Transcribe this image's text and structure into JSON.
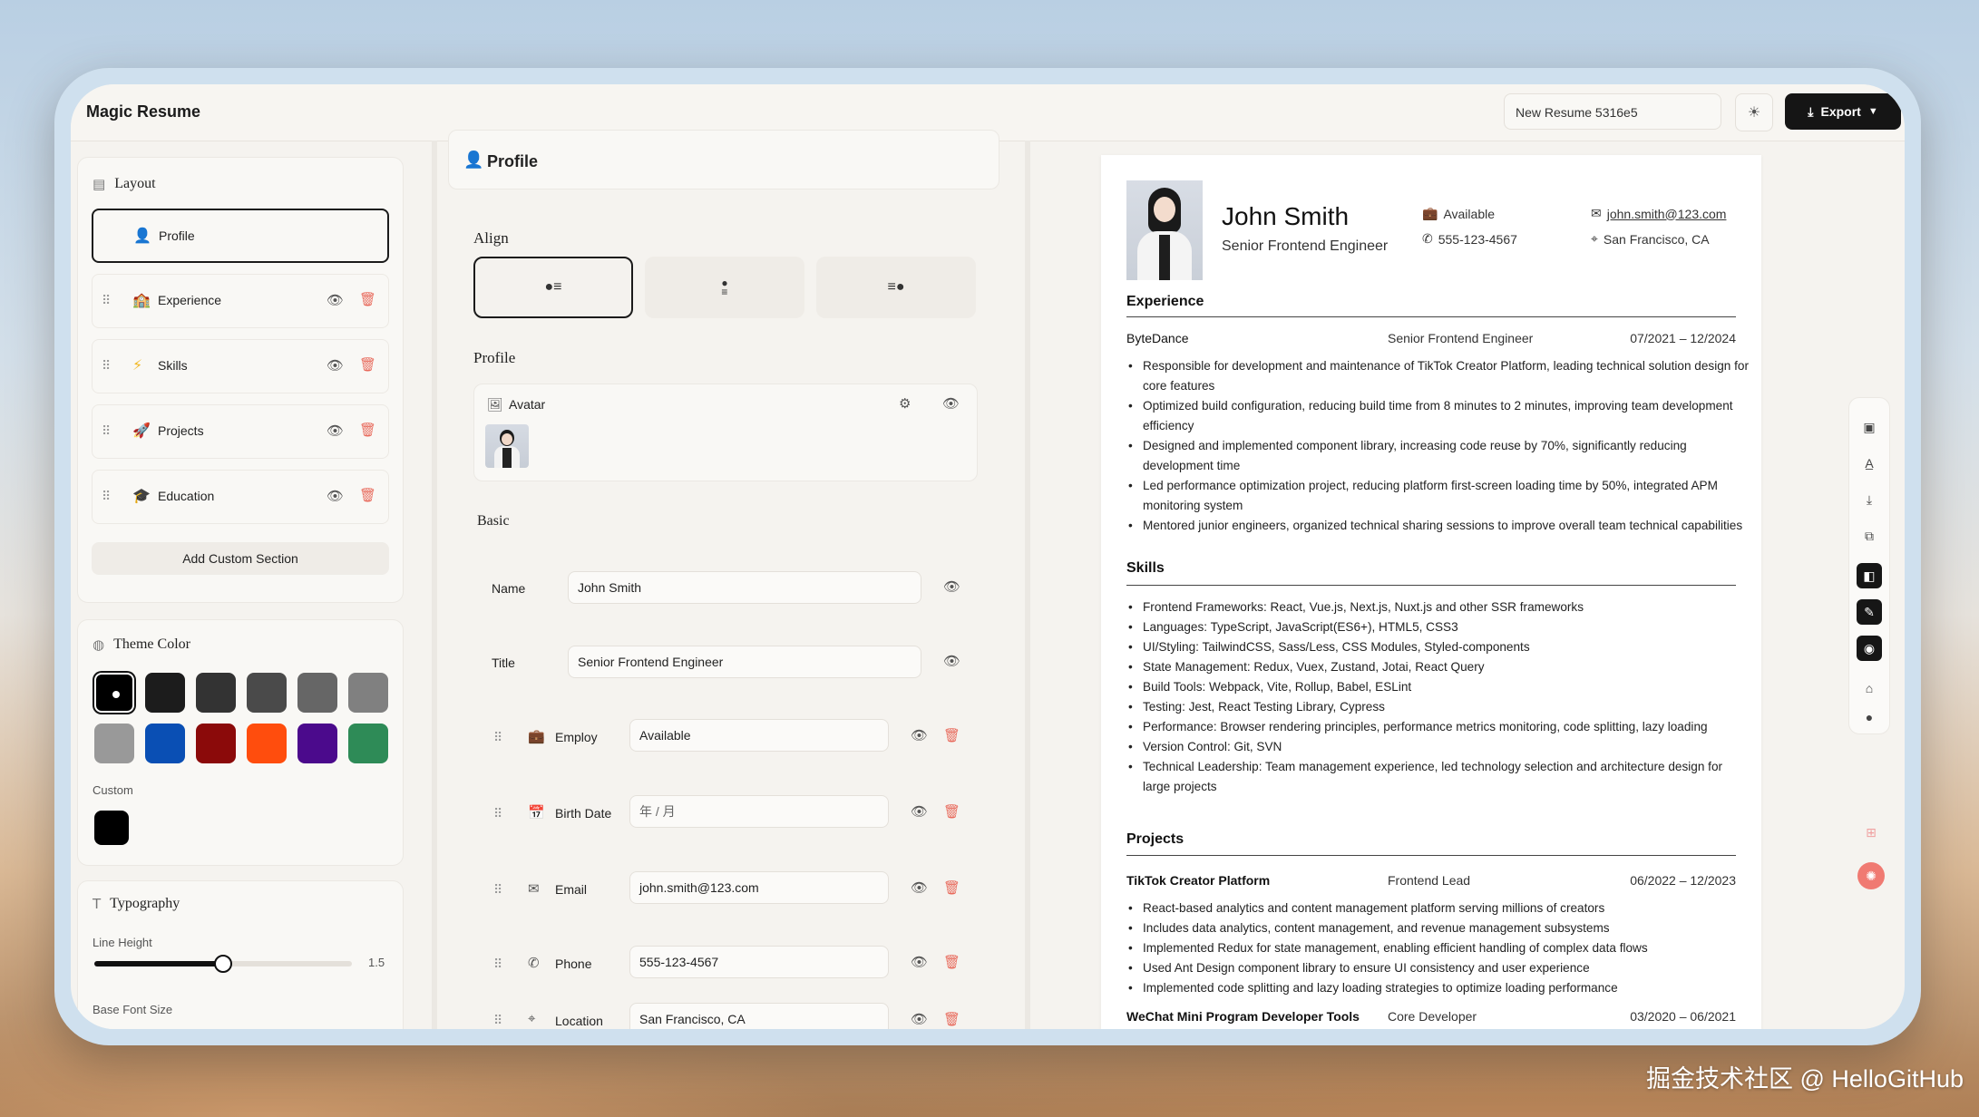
{
  "app": {
    "title": "Magic Resume",
    "resume_name": "New Resume 5316e5",
    "export_label": "Export"
  },
  "layout": {
    "title": "Layout",
    "sections": [
      {
        "label": "Profile"
      },
      {
        "label": "Experience"
      },
      {
        "label": "Skills"
      },
      {
        "label": "Projects"
      },
      {
        "label": "Education"
      }
    ],
    "add_custom_label": "Add Custom Section"
  },
  "theme": {
    "title": "Theme Color",
    "colors": [
      "#000000",
      "#1c1c1c",
      "#333333",
      "#4a4a4a",
      "#666666",
      "#808080",
      "#999999",
      "#0a4fb4",
      "#8b0a0a",
      "#ff4d0d",
      "#4b0a8c",
      "#2e8b57"
    ],
    "custom_label": "Custom",
    "custom_color": "#000000"
  },
  "typography": {
    "title": "Typography",
    "line_height_label": "Line Height",
    "line_height_value": "1.5",
    "line_height_fraction": 0.5,
    "base_font_label": "Base Font Size"
  },
  "editor": {
    "header": "Profile",
    "align_title": "Align",
    "profile_title": "Profile",
    "avatar_label": "Avatar",
    "basic_title": "Basic",
    "name_label": "Name",
    "name_value": "John Smith",
    "title_label": "Title",
    "title_value": "Senior Frontend Engineer",
    "fields": [
      {
        "label": "Employ",
        "value": "Available"
      },
      {
        "label": "Birth Date",
        "value": "年 / 月"
      },
      {
        "label": "Email",
        "value": "john.smith@123.com"
      },
      {
        "label": "Phone",
        "value": "555-123-4567"
      },
      {
        "label": "Location",
        "value": "San Francisco, CA"
      }
    ]
  },
  "resume": {
    "name": "John Smith",
    "title": "Senior Frontend Engineer",
    "employ": "Available",
    "phone": "555-123-4567",
    "email": "john.smith@123.com",
    "location": "San Francisco, CA",
    "experience_title": "Experience",
    "experience": {
      "company": "ByteDance",
      "position": "Senior Frontend Engineer",
      "date": "07/2021 – 12/2024",
      "bullets": [
        "Responsible for development and maintenance of TikTok Creator Platform, leading technical solution design for core features",
        "Optimized build configuration, reducing build time from 8 minutes to 2 minutes, improving team development efficiency",
        "Designed and implemented component library, increasing code reuse by 70%, significantly reducing development time",
        "Led performance optimization project, reducing platform first-screen loading time by 50%, integrated APM monitoring system",
        "Mentored junior engineers, organized technical sharing sessions to improve overall team technical capabilities"
      ]
    },
    "skills_title": "Skills",
    "skills": [
      "Frontend Frameworks: React, Vue.js, Next.js, Nuxt.js and other SSR frameworks",
      "Languages: TypeScript, JavaScript(ES6+), HTML5, CSS3",
      "UI/Styling: TailwindCSS, Sass/Less, CSS Modules, Styled-components",
      "State Management: Redux, Vuex, Zustand, Jotai, React Query",
      "Build Tools: Webpack, Vite, Rollup, Babel, ESLint",
      "Testing: Jest, React Testing Library, Cypress",
      "Performance: Browser rendering principles, performance metrics monitoring, code splitting, lazy loading",
      "Version Control: Git, SVN",
      "Technical Leadership: Team management experience, led technology selection and architecture design for large projects"
    ],
    "projects_title": "Projects",
    "project1": {
      "name": "TikTok Creator Platform",
      "role": "Frontend Lead",
      "date": "06/2022 – 12/2023",
      "bullets": [
        "React-based analytics and content management platform serving millions of creators",
        "Includes data analytics, content management, and revenue management subsystems",
        "Implemented Redux for state management, enabling efficient handling of complex data flows",
        "Used Ant Design component library to ensure UI consistency and user experience",
        "Implemented code splitting and lazy loading strategies to optimize loading performance"
      ]
    },
    "project2": {
      "name": "WeChat Mini Program Developer Tools",
      "role": "Core Developer",
      "date": "03/2020 – 06/2021"
    }
  },
  "watermark": "掘金技术社区 @ HelloGitHub"
}
